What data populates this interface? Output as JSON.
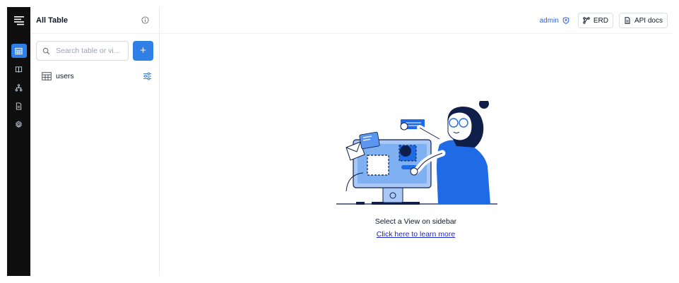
{
  "rail": {
    "items": [
      {
        "name": "tables",
        "icon": "table-icon",
        "active": true
      },
      {
        "name": "docs",
        "icon": "book-icon",
        "active": false
      },
      {
        "name": "erd",
        "icon": "hierarchy-icon",
        "active": false
      },
      {
        "name": "files",
        "icon": "file-icon",
        "active": false
      },
      {
        "name": "settings",
        "icon": "gear-icon",
        "active": false
      }
    ]
  },
  "sidebar": {
    "title": "All Table",
    "search_placeholder": "Search table or vi...",
    "add_label": "+",
    "tables": [
      {
        "name": "users"
      }
    ]
  },
  "topbar": {
    "user": "admin",
    "erd_label": "ERD",
    "api_docs_label": "API docs"
  },
  "main": {
    "empty_message": "Select a View on sidebar",
    "learn_more_link": "Click here to learn more"
  },
  "colors": {
    "accent": "#2f7fe6",
    "rail_bg": "#0f0f10",
    "link": "#1d27c9",
    "illustration_blue": "#1f6be6",
    "illustration_light": "#a9c8f5",
    "illustration_dark": "#0f1f4a"
  }
}
